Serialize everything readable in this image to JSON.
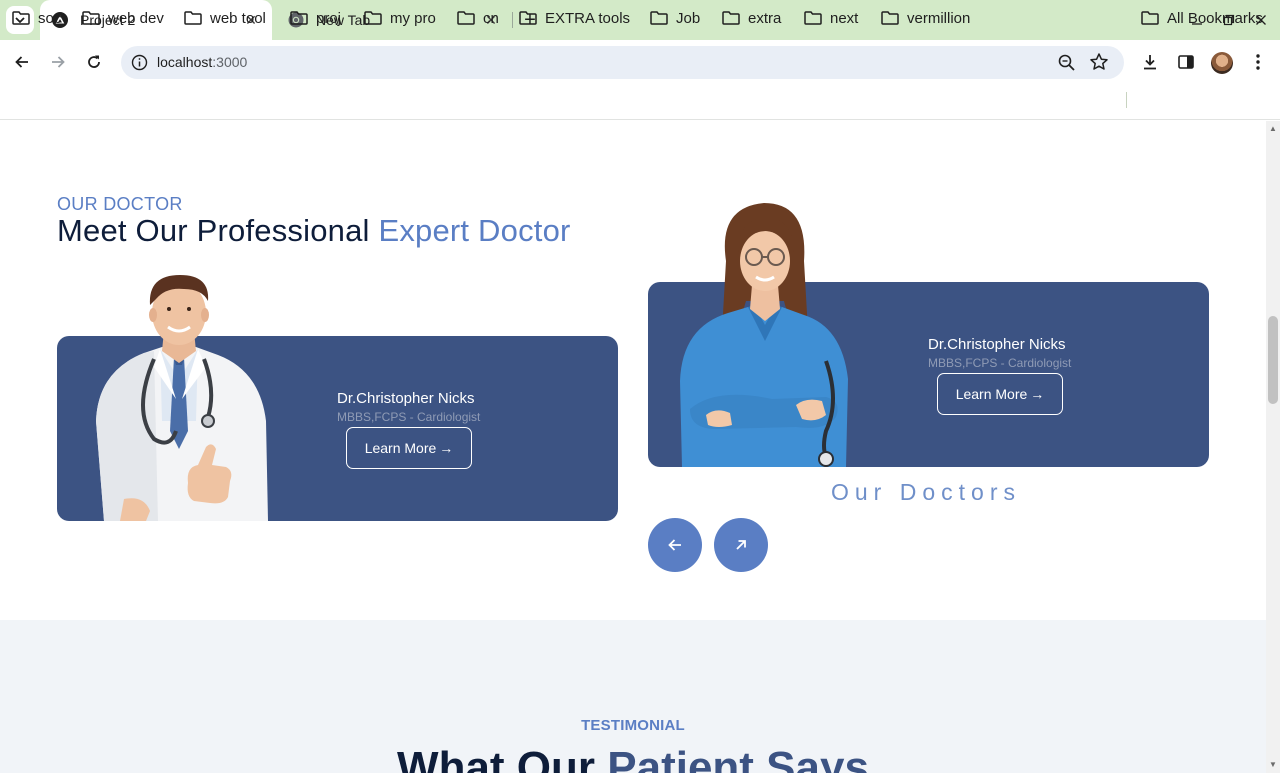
{
  "browser": {
    "tabs": [
      {
        "title": "Project 2",
        "active": true
      },
      {
        "title": "New Tab",
        "active": false
      }
    ],
    "url_host": "localhost",
    "url_port": ":3000",
    "bookmarks": [
      "soc",
      "web dev",
      "web tool",
      "proj",
      "my pro",
      "cn",
      "EXTRA tools",
      "Job",
      "extra",
      "next",
      "vermillion"
    ],
    "all_bookmarks_label": "All Bookmarks"
  },
  "doctors_section": {
    "eyebrow": "OUR DOCTOR",
    "heading_main": "Meet Our Professional ",
    "heading_accent": "Expert Doctor",
    "cards": [
      {
        "name": "Dr.Christopher Nicks",
        "credentials": "MBBS,FCPS - Cardiologist",
        "button_label": "Learn More",
        "button_arrow": "→"
      },
      {
        "name": "Dr.Christopher Nicks",
        "credentials": "MBBS,FCPS - Cardiologist",
        "button_label": "Learn More",
        "button_arrow": "→"
      }
    ],
    "our_doctors_label": "Our Doctors",
    "prev_icon": "arrow-left-icon",
    "next_icon": "arrow-up-right-icon"
  },
  "testimonial_section": {
    "eyebrow": "TESTIMONIAL",
    "heading_main": "What Our ",
    "heading_accent": "Patient Says"
  },
  "colors": {
    "accent": "#5a7ec4",
    "card": "#3c5383",
    "heading": "#0e1d3a",
    "tabbar": "#d3eac8"
  }
}
